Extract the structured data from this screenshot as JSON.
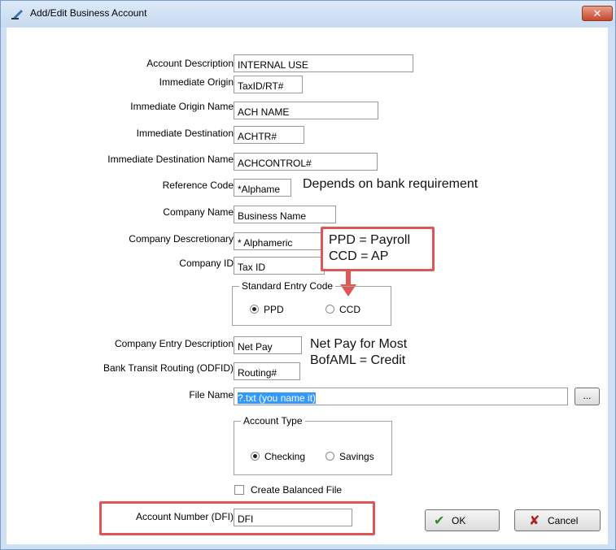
{
  "window": {
    "title": "Add/Edit Business Account",
    "close_glyph": "✕"
  },
  "fields": [
    {
      "label": "Account Description",
      "value": "INTERNAL USE"
    },
    {
      "label": "Immediate Origin",
      "value": "TaxID/RT#"
    },
    {
      "label": "Immediate Origin Name",
      "value": "ACH NAME"
    },
    {
      "label": "Immediate Destination",
      "value": "ACHTR#"
    },
    {
      "label": "Immediate Destination Name",
      "value": "ACHCONTROL#"
    },
    {
      "label": "Reference Code",
      "value": "*Alphame"
    },
    {
      "label": "Company Name",
      "value": "Business Name"
    },
    {
      "label": "Company Descretionary",
      "value": "* Alphameric"
    },
    {
      "label": "Company ID",
      "value": "Tax ID"
    },
    {
      "label": "Company Entry Description",
      "value": "Net Pay"
    },
    {
      "label": "Bank Transit Routing (ODFID)",
      "value": "Routing#"
    },
    {
      "label": "File Name",
      "value": "?.txt (you name it)"
    },
    {
      "label": "Account Number (DFI)",
      "value": "DFI"
    }
  ],
  "notes": {
    "reference": "Depends on bank requirement",
    "sec_line1": "PPD = Payroll",
    "sec_line2": "CCD = AP",
    "entry_line1": "Net Pay for Most",
    "entry_line2": "BofAML = Credit"
  },
  "standard_entry_code": {
    "legend": "Standard Entry Code",
    "options": [
      {
        "label": "PPD",
        "selected": true
      },
      {
        "label": "CCD",
        "selected": false
      }
    ]
  },
  "account_type": {
    "legend": "Account Type",
    "options": [
      {
        "label": "Checking",
        "selected": true
      },
      {
        "label": "Savings",
        "selected": false
      }
    ]
  },
  "balanced_file": {
    "label": "Create Balanced File",
    "checked": false
  },
  "browse_label": "...",
  "buttons": {
    "ok": "OK",
    "cancel": "Cancel",
    "ok_glyph": "✔",
    "cancel_glyph": "✘"
  },
  "colors": {
    "annotation_red": "#e05555",
    "selection_blue": "#3399ff",
    "title_bar": "#cfe0f4"
  }
}
